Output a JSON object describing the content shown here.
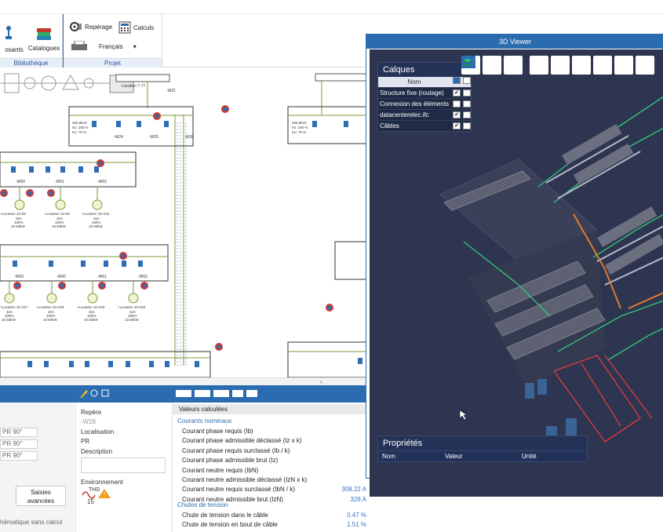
{
  "ribbon": {
    "library": {
      "group_label": "Bibliothèque",
      "components_label": "osants",
      "catalogues_label": "Catalogues"
    },
    "project": {
      "group_label": "Projet",
      "reperage_label": "Repérage",
      "calculs_label": "Calculs",
      "language_value": "Français"
    }
  },
  "schematic": {
    "labels": {
      "loc77": "Location 7-77",
      "loc1": "+Location 10-X8",
      "loc2": "+Location 10-X9",
      "loc3": "+Location 10-X10",
      "loc4": "+Location 10-X17",
      "loc5": "+Location 10-X18",
      "loc6": "+Location 10-X19",
      "loc7": "+Location 10-X20",
      "w21": "-W21",
      "w24": "-W24",
      "w25": "-W25",
      "w26": "-W26",
      "w50": "-W50",
      "w51": "-W51",
      "w52": "-W52",
      "w59": "-W59",
      "w60": "-W60",
      "w61": "-W61",
      "w62": "-W62",
      "amp": "32A",
      "pct": "100%",
      "kw": "10.94kW",
      "cell_small": "325.5kVA",
      "kvs_label": "Ks: 100 %",
      "ku_label": "Ku: 70 %"
    }
  },
  "bottom": {
    "left": {
      "fields": [
        "PR 90°",
        "PR 90°",
        "PR 90°"
      ],
      "advanced_button": "Saisies avancées",
      "note": "hématique sans calcul"
    },
    "mid": {
      "repere_label": "Repère",
      "repere_value": "-W26",
      "localisation_label": "Localisation",
      "localisation_value": "PR",
      "description_label": "Description",
      "environnement_label": "Environnement",
      "thd_label": "THD",
      "thd_value": "15"
    },
    "right": {
      "header": "Valeurs calculées",
      "section1": "Courants nominaux",
      "rows1": [
        {
          "name": "Courant phase requis (Ib)",
          "value": ""
        },
        {
          "name": "Courant phase admissible déclassé (Iz x k)",
          "value": ""
        },
        {
          "name": "Courant phase requis surclassé (Ib / k)",
          "value": ""
        },
        {
          "name": "Courant phase admissible brut (Iz)",
          "value": ""
        },
        {
          "name": "Courant neutre requis (IbN)",
          "value": ""
        },
        {
          "name": "Courant neutre admissible déclassé (IzN x k)",
          "value": ""
        },
        {
          "name": "Courant neutre requis surclassé (IbN / k)",
          "value": "308.22 A"
        },
        {
          "name": "Courant neutre admissible brut (IzN)",
          "value": "328 A"
        }
      ],
      "section2": "Chutes de tension",
      "rows2": [
        {
          "name": "Chute de tension dans le câble",
          "value": "0.47 %"
        },
        {
          "name": "Chute de tension en bout de câble",
          "value": "1.51 %"
        }
      ]
    }
  },
  "viewer": {
    "title": "3D Viewer",
    "layers": {
      "title": "Calques",
      "col_name": "Nom",
      "rows": [
        {
          "name": "Structure fixe (routage)",
          "visible": true,
          "locked": false
        },
        {
          "name": "Connexion des éléments",
          "visible": false,
          "locked": false
        },
        {
          "name": "datacenterelec.ifc",
          "visible": true,
          "locked": false
        },
        {
          "name": "Câbles",
          "visible": true,
          "locked": false
        }
      ]
    },
    "properties": {
      "title": "Propriétés",
      "columns": [
        "Nom",
        "Valeur",
        "Unité"
      ]
    },
    "toolbar": [
      "table-icon",
      "home-icon",
      "layers-icon",
      "hide-icon",
      "show-all-icon",
      "cube-icon",
      "ghost-icon",
      "fit-icon",
      "settings-icon"
    ]
  }
}
